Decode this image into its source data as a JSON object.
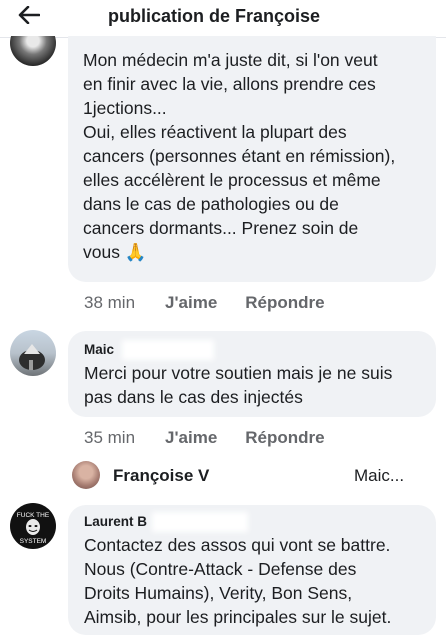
{
  "header": {
    "title": "publication de Françoise",
    "back_icon": "arrow-left-icon"
  },
  "comments": [
    {
      "author": "",
      "text": "Mon médecin m'a juste dit, si l'on veut\nen finir avec la vie, allons prendre ces\n1jections...\nOui, elles réactivent la plupart des\ncancers (personnes étant en rémission),\nelles accélèrent le processus et même\ndans le cas de pathologies ou de\ncancers dormants... Prenez soin de\nvous 🙏",
      "time": "38 min",
      "like": "J'aime",
      "reply": "Répondre"
    },
    {
      "author": "Maic",
      "text": "Merci pour votre soutien mais je ne suis\npas dans le cas des injectés",
      "time": "35 min",
      "like": "J'aime",
      "reply": "Répondre"
    },
    {
      "author": "Laurent B",
      "text": "Contactez des assos qui vont se battre.\nNous (Contre-Attack - Defense des\nDroits Humains), Verity, Bon Sens,\nAimsib, pour les principales sur le sujet.",
      "avatar_text": [
        "FUCK THE",
        "SYSTEM"
      ]
    }
  ],
  "reply_preview": {
    "name": "Françoise V",
    "reply_to": "Maic..."
  },
  "colors": {
    "bubble": "#f0f2f5",
    "meta": "#65676b",
    "text": "#1c1e21"
  }
}
